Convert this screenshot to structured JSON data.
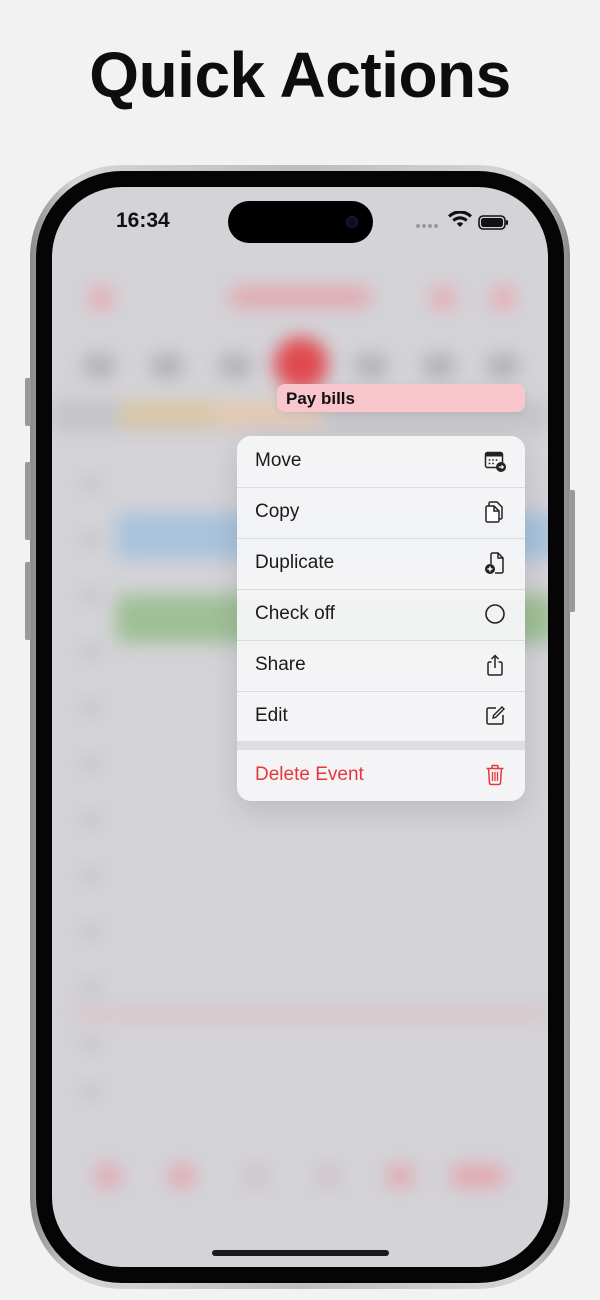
{
  "headline": "Quick Actions",
  "status_bar": {
    "time": "16:34"
  },
  "event": {
    "title": "Pay bills",
    "color": "#f9c6cd"
  },
  "context_menu": {
    "items": [
      {
        "label": "Move",
        "icon": "calendar-move-icon"
      },
      {
        "label": "Copy",
        "icon": "copy-icon"
      },
      {
        "label": "Duplicate",
        "icon": "duplicate-icon"
      },
      {
        "label": "Check off",
        "icon": "circle-icon"
      },
      {
        "label": "Share",
        "icon": "share-icon"
      },
      {
        "label": "Edit",
        "icon": "edit-icon"
      }
    ],
    "destructive": {
      "label": "Delete Event",
      "icon": "trash-icon",
      "color": "#e5383b"
    }
  },
  "colors": {
    "accent": "#e5383b",
    "background": "#f2f2f2",
    "screen_dim": "#d4d3d8"
  }
}
